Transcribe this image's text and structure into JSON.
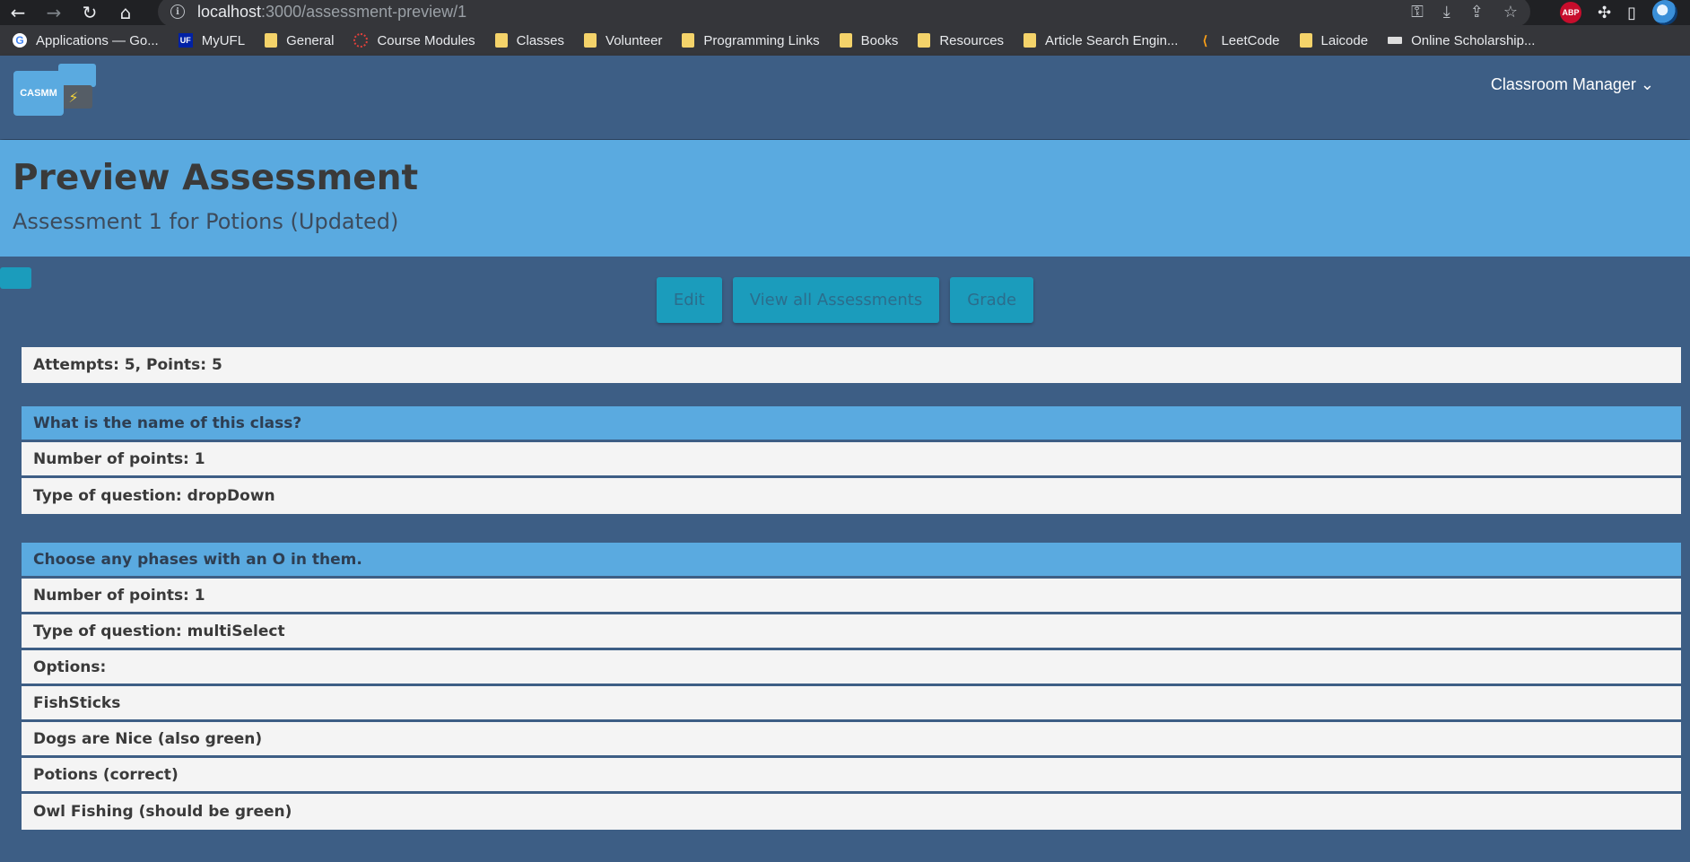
{
  "browser": {
    "url_host": "localhost",
    "url_rest": ":3000/assessment-preview/1",
    "bookmarks": [
      {
        "label": "Applications — Go...",
        "icon": "google-icon"
      },
      {
        "label": "MyUFL",
        "icon": "uf-icon"
      },
      {
        "label": "General",
        "icon": "folder-icon"
      },
      {
        "label": "Course Modules",
        "icon": "canvas-icon"
      },
      {
        "label": "Classes",
        "icon": "folder-icon"
      },
      {
        "label": "Volunteer",
        "icon": "folder-icon"
      },
      {
        "label": "Programming Links",
        "icon": "folder-icon"
      },
      {
        "label": "Books",
        "icon": "folder-icon"
      },
      {
        "label": "Resources",
        "icon": "folder-icon"
      },
      {
        "label": "Article Search Engin...",
        "icon": "folder-icon"
      },
      {
        "label": "LeetCode",
        "icon": "leetcode-icon"
      },
      {
        "label": "Laicode",
        "icon": "folder-icon"
      },
      {
        "label": "Online Scholarship...",
        "icon": "scholarship-icon"
      }
    ]
  },
  "navbar": {
    "logo_text": "CASMM",
    "menu_label": "Classroom Manager"
  },
  "header": {
    "title": "Preview Assessment",
    "subtitle": "Assessment 1 for Potions (Updated)"
  },
  "actions": {
    "edit": "Edit",
    "view_all": "View all Assessments",
    "grade": "Grade"
  },
  "summary": "Attempts: 5, Points: 5",
  "questions": [
    {
      "title": "What is the name of this class?",
      "points": "Number of points: 1",
      "type": "Type of question: dropDown"
    },
    {
      "title": "Choose any phases with an O in them.",
      "points": "Number of points: 1",
      "type": "Type of question: multiSelect",
      "options_label": "Options:",
      "options": [
        "FishSticks",
        "Dogs are Nice (also green)",
        "Potions (correct)",
        "Owl Fishing (should be green)"
      ]
    }
  ],
  "colors": {
    "page_bg": "#3d5e85",
    "accent": "#5aaae0",
    "button": "#1b9cbc"
  }
}
